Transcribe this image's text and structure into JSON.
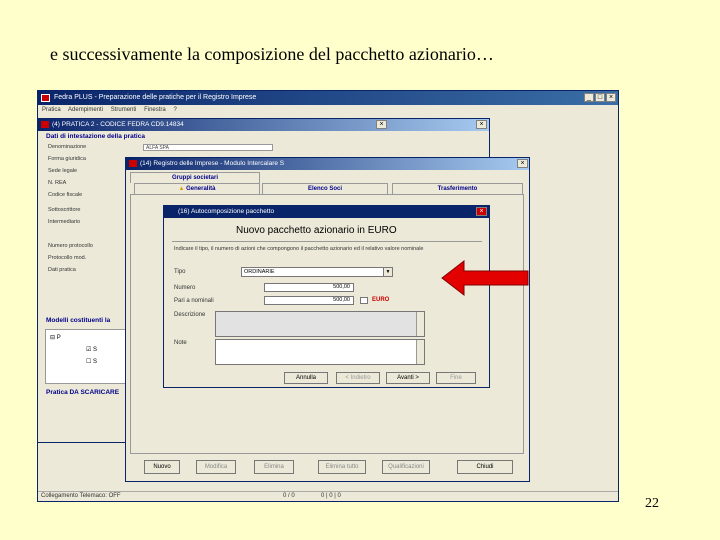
{
  "slide": {
    "title": "e successivamente la composizione del pacchetto azionario…",
    "page_number": "22"
  },
  "app": {
    "title": "Fedra PLUS - Preparazione delle pratiche per il Registro Imprese",
    "menu": [
      "Pratica",
      "Adempimenti",
      "Strumenti",
      "Finestra",
      "?"
    ],
    "status_left": "Collegamento Telemaco: OFF",
    "status_right": "0 / 0",
    "status_cells": "0 | 0 | 0"
  },
  "w4": {
    "title": "(4) PRATICA 2 - CODICE FEDRA CD9.14834",
    "section_title": "Dati di intestazione della pratica",
    "fields": [
      {
        "label": "Denominazione",
        "value": "ALFA SPA"
      },
      {
        "label": "Forma giuridica",
        "value": ""
      },
      {
        "label": "Sede legale",
        "value": ""
      },
      {
        "label": "N. REA",
        "value": ""
      },
      {
        "label": "Codice fiscale",
        "value": ""
      },
      {
        "label": "Sottoscrittore",
        "value": ""
      },
      {
        "label": "Intermediario",
        "value": ""
      },
      {
        "label": "Numero protocollo",
        "value": ""
      },
      {
        "label": "Protocollo mod.",
        "value": ""
      },
      {
        "label": "Dati pratica",
        "value": ""
      }
    ],
    "models_title": "Modelli costituenti la",
    "tree_items": [
      "P",
      "S",
      "S"
    ],
    "footer_title": "Pratica DA SCARICARE"
  },
  "w14": {
    "title": "(14) Registro delle Imprese - Modulo Intercalare S",
    "group_title": "Gruppi societari",
    "tabs": [
      "Generalità",
      "Elenco Soci",
      "Trasferimento"
    ],
    "buttons": {
      "new": "Nuovo",
      "modify": "Modifica",
      "delete": "Elimina",
      "delete_all": "Elimina tutto",
      "qualifications": "Qualificazioni",
      "close": "Chiudi"
    }
  },
  "w16": {
    "title": "(16) Autocomposizione pacchetto",
    "heading": "Nuovo pacchetto azionario in EURO",
    "instructions": "Indicare il tipo, il numero di azioni che compongono il pacchetto azionario ed il relativo valore nominale",
    "labels": {
      "tipo": "Tipo",
      "numero": "Numero",
      "pari": "Pari a nominali",
      "descrizione": "Descrizione",
      "note": "Note"
    },
    "tipo_value": "ORDINARIE",
    "numero_value": "500,00",
    "pari_value": "500,00",
    "currency": "EURO",
    "buttons": {
      "cancel": "Annulla",
      "back": "< Indietro",
      "next": "Avanti >",
      "finish": "Fine"
    }
  },
  "colors": {
    "arrow": "#e30000",
    "slide_bg": "#ffffcc",
    "titlebar": "#0a246a"
  }
}
